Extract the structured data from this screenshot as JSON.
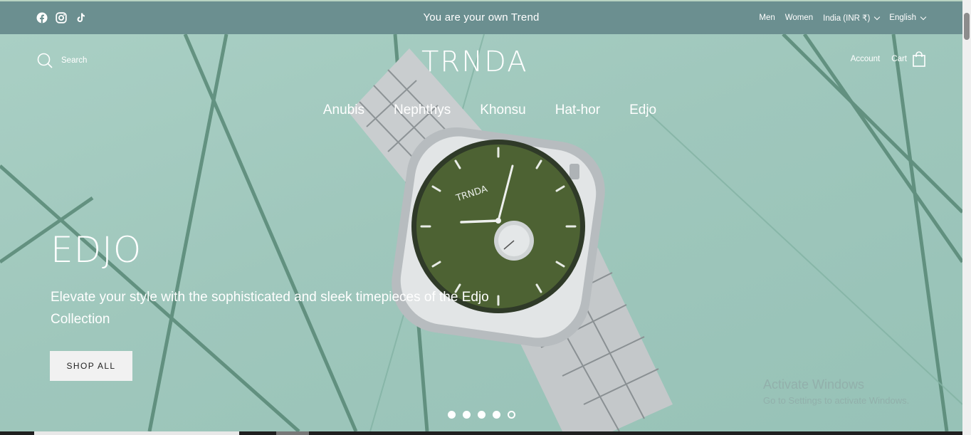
{
  "topbar": {
    "announcement": "You are your own Trend",
    "social": [
      {
        "icon": "facebook-icon"
      },
      {
        "icon": "instagram-icon"
      },
      {
        "icon": "tiktok-icon"
      }
    ],
    "links": [
      "Men",
      "Women"
    ],
    "country": "India (INR ₹)",
    "language": "English"
  },
  "header": {
    "search_label": "Search",
    "logo": "TRNDA",
    "account_label": "Account",
    "cart_label": "Cart"
  },
  "nav": {
    "items": [
      "Anubis",
      "Nephthys",
      "Khonsu",
      "Hat-hor",
      "Edjo"
    ]
  },
  "slide": {
    "title": "EDJO",
    "text": "Elevate your style with the sophisticated and sleek timepieces of the Edjo Collection",
    "button": "SHOP ALL",
    "dot_count": 5,
    "active_dot": 5
  },
  "watch": {
    "brand": "TRNDA",
    "dial_color": "#4d6233"
  },
  "watermark": {
    "line1": "Activate Windows",
    "line2": "Go to Settings to activate Windows."
  },
  "colors": {
    "topbar": "#6b8f90",
    "hero": "#a3cbbf",
    "accent": "#ffffff"
  }
}
